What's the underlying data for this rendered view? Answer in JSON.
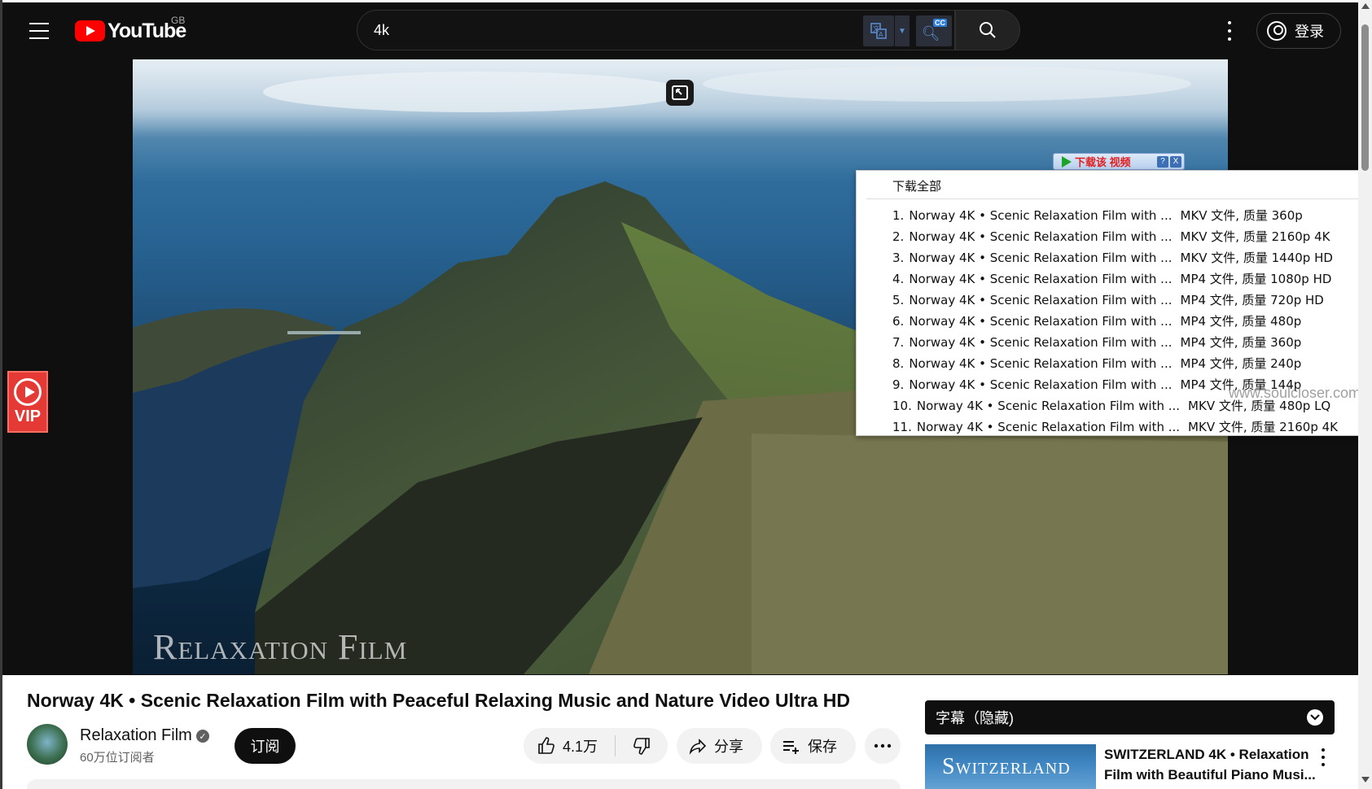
{
  "masthead": {
    "logo_text": "YouTube",
    "region": "GB",
    "search_value": "4k",
    "signin_label": "登录",
    "icons": [
      "menu-icon",
      "youtube-logo",
      "translate-icon",
      "cc-search-icon",
      "search-icon",
      "more-vert-icon",
      "account-icon"
    ]
  },
  "video": {
    "watermark": "Relaxation Film"
  },
  "vip_badge": {
    "label": "VIP"
  },
  "download_ext": {
    "bar_label": "下载该 视频",
    "help": "?",
    "close": "X",
    "all_label": "下载全部",
    "items": [
      {
        "num": "1.",
        "title": "Norway 4K • Scenic Relaxation Film with ...",
        "format": "MKV 文件, 质量 360p"
      },
      {
        "num": "2.",
        "title": "Norway 4K • Scenic Relaxation Film with ...",
        "format": "MKV 文件, 质量 2160p 4K"
      },
      {
        "num": "3.",
        "title": "Norway 4K • Scenic Relaxation Film with ...",
        "format": "MKV 文件, 质量 1440p HD"
      },
      {
        "num": "4.",
        "title": "Norway 4K • Scenic Relaxation Film with ...",
        "format": "MP4 文件, 质量 1080p HD"
      },
      {
        "num": "5.",
        "title": "Norway 4K • Scenic Relaxation Film with ...",
        "format": "MP4 文件, 质量 720p HD"
      },
      {
        "num": "6.",
        "title": "Norway 4K • Scenic Relaxation Film with ...",
        "format": "MP4 文件, 质量 480p"
      },
      {
        "num": "7.",
        "title": "Norway 4K • Scenic Relaxation Film with ...",
        "format": "MP4 文件, 质量 360p"
      },
      {
        "num": "8.",
        "title": "Norway 4K • Scenic Relaxation Film with ...",
        "format": "MP4 文件, 质量 240p"
      },
      {
        "num": "9.",
        "title": "Norway 4K • Scenic Relaxation Film with ...",
        "format": "MP4 文件, 质量 144p"
      },
      {
        "num": "10.",
        "title": "Norway 4K • Scenic Relaxation Film with ...",
        "format": "MKV 文件, 质量 480p LQ"
      },
      {
        "num": "11.",
        "title": "Norway 4K • Scenic Relaxation Film with ...",
        "format": "MKV 文件, 质量 2160p 4K"
      }
    ],
    "watermark": "www.soulcloser.com"
  },
  "watch": {
    "title": "Norway 4K • Scenic Relaxation Film with Peaceful Relaxing Music and Nature Video Ultra HD",
    "channel_name": "Relaxation Film",
    "subscribers": "60万位订阅者",
    "subscribe_label": "订阅",
    "like_count": "4.1万",
    "share_label": "分享",
    "save_label": "保存"
  },
  "sidebar": {
    "subtitles_panel": "字幕（隐藏)",
    "rec": {
      "thumb_text": "Switzerland",
      "title": "SWITZERLAND 4K • Relaxation Film with Beautiful Piano Musi..."
    }
  },
  "colors": {
    "brand_red": "#ff0000",
    "dark_bg": "#0f0f0f",
    "vip_red": "#e53935"
  }
}
